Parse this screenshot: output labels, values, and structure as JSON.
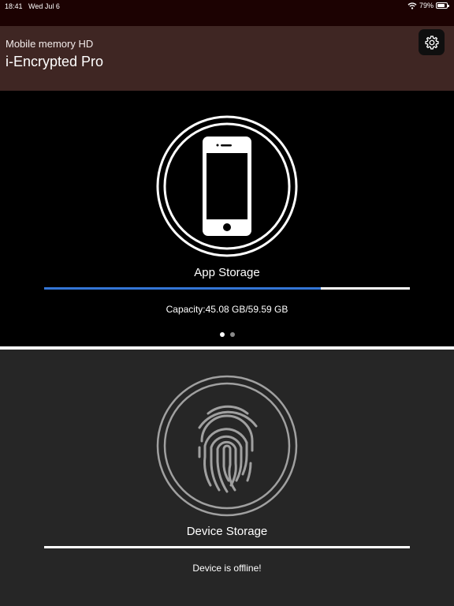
{
  "status_bar": {
    "time": "18:41",
    "date": "Wed Jul 6",
    "battery_percent": "79%",
    "battery_level": 0.79,
    "icons": [
      "wifi-icon",
      "battery-charging-icon"
    ]
  },
  "header": {
    "subtitle": "Mobile memory HD",
    "title": "i-Encrypted Pro",
    "settings_icon": "gear-icon",
    "background": "#3f2623"
  },
  "app_storage": {
    "icon": "phone-icon",
    "label": "App Storage",
    "capacity_text": "Capacity:45.08 GB/59.59 GB",
    "used_gb": 45.08,
    "total_gb": 59.59,
    "progress_color": "#3476d6",
    "page_dots": {
      "count": 2,
      "active_index": 0
    }
  },
  "device_storage": {
    "icon": "fingerprint-icon",
    "label": "Device Storage",
    "status_text": "Device is offline!",
    "background": "#262626"
  }
}
